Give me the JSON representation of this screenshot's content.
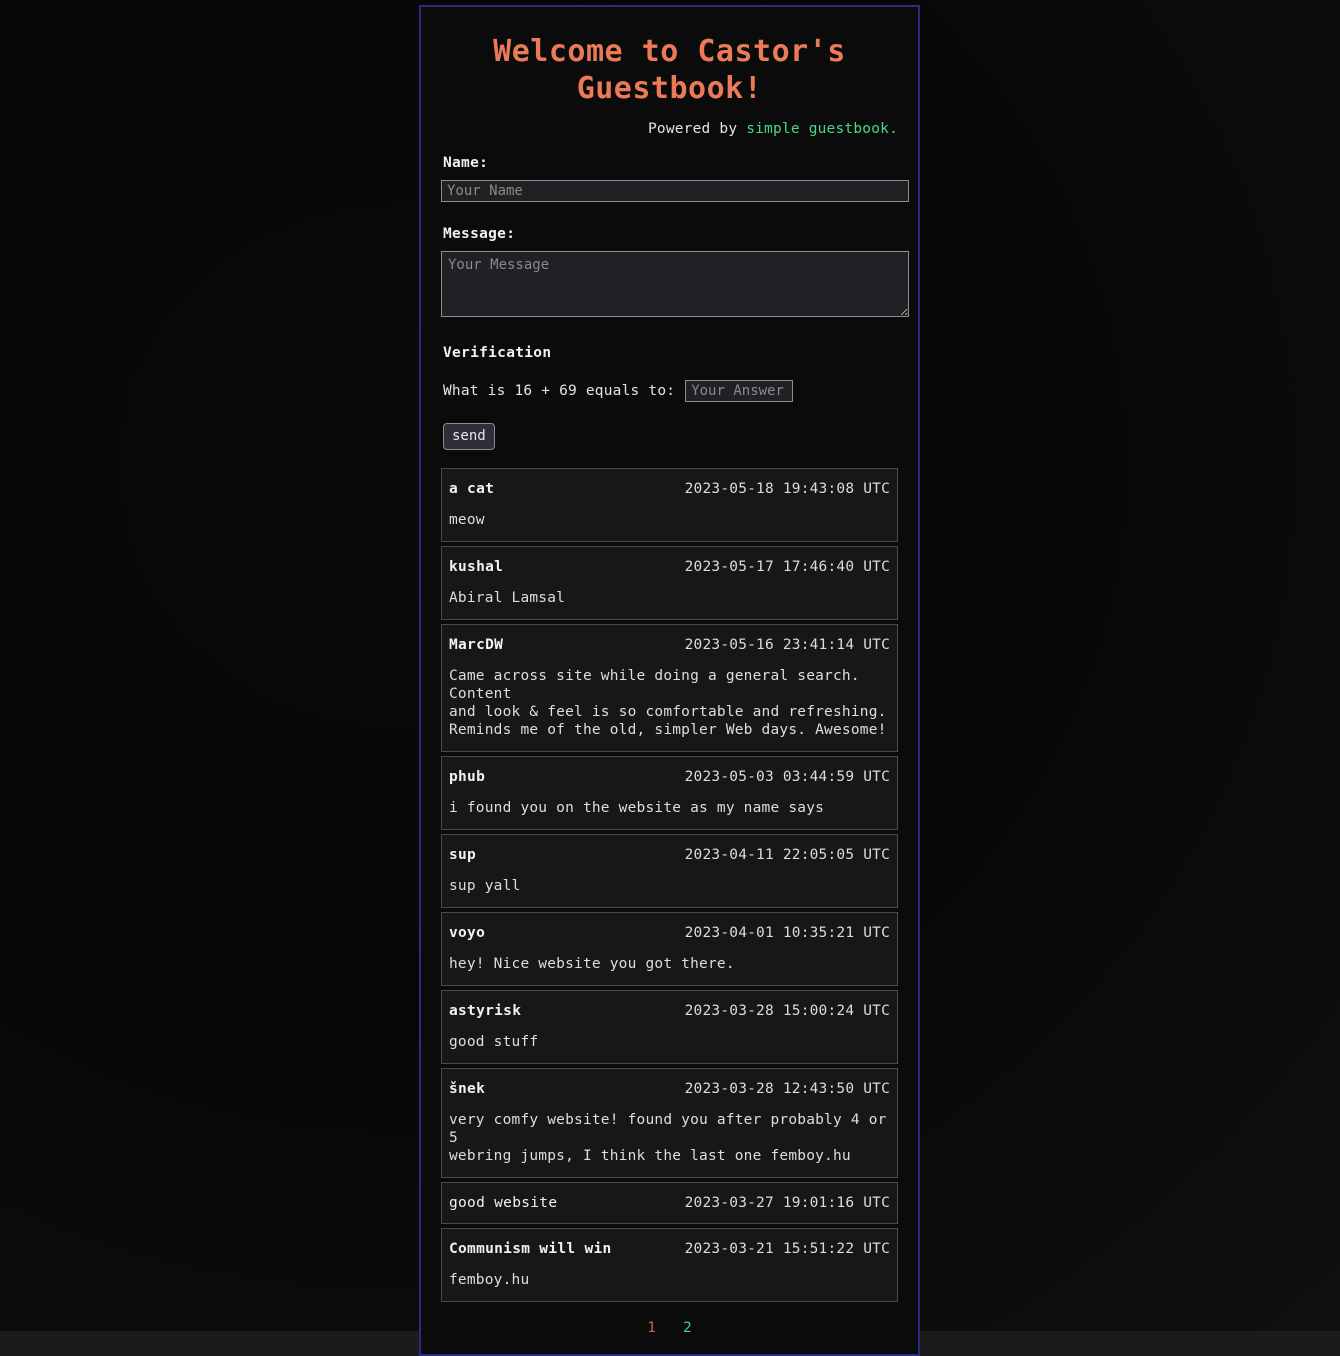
{
  "header": {
    "title": "Welcome to Castor's Guestbook!",
    "powered_prefix": "Powered by ",
    "powered_link": "simple guestbook.",
    "title_color": "#ea7a58",
    "link_color": "#47d98a"
  },
  "form": {
    "name_label": "Name:",
    "name_placeholder": "Your Name",
    "name_value": "",
    "message_label": "Message:",
    "message_placeholder": "Your Message",
    "message_value": "",
    "verification_heading": "Verification",
    "verification_question": "What is 16 + 69 equals to:",
    "answer_placeholder": "Your Answer",
    "answer_value": "",
    "send_label": "send"
  },
  "entries": [
    {
      "name": "a cat",
      "name_bold": true,
      "date": "2023-05-18 19:43:08 UTC",
      "message": "meow"
    },
    {
      "name": "kushal",
      "name_bold": true,
      "date": "2023-05-17 17:46:40 UTC",
      "message": "Abiral Lamsal"
    },
    {
      "name": "MarcDW",
      "name_bold": true,
      "date": "2023-05-16 23:41:14 UTC",
      "message": "Came across site while doing a general search. Content\nand look & feel is so comfortable and refreshing.\nReminds me of the old, simpler Web days. Awesome!"
    },
    {
      "name": "phub",
      "name_bold": true,
      "date": "2023-05-03 03:44:59 UTC",
      "message": "i found you on the website as my name says"
    },
    {
      "name": "sup",
      "name_bold": true,
      "date": "2023-04-11 22:05:05 UTC",
      "message": "sup yall"
    },
    {
      "name": "voyo",
      "name_bold": true,
      "date": "2023-04-01 10:35:21 UTC",
      "message": "hey! Nice website you got there."
    },
    {
      "name": "astyrisk",
      "name_bold": true,
      "date": "2023-03-28 15:00:24 UTC",
      "message": "good stuff"
    },
    {
      "name": "šnek",
      "name_bold": true,
      "date": "2023-03-28 12:43:50 UTC",
      "message": "very comfy website! found you after probably 4 or 5\nwebring jumps, I think the last one femboy.hu"
    },
    {
      "name": "good website",
      "name_bold": false,
      "date": "2023-03-27 19:01:16 UTC",
      "message": ""
    },
    {
      "name": "Communism will win",
      "name_bold": true,
      "date": "2023-03-21 15:51:22 UTC",
      "message": "femboy.hu"
    }
  ],
  "pagination": {
    "pages": [
      {
        "label": "1",
        "current": true
      },
      {
        "label": "2",
        "current": false
      }
    ],
    "current_color": "#c4664d",
    "link_color": "#3fc98a"
  }
}
